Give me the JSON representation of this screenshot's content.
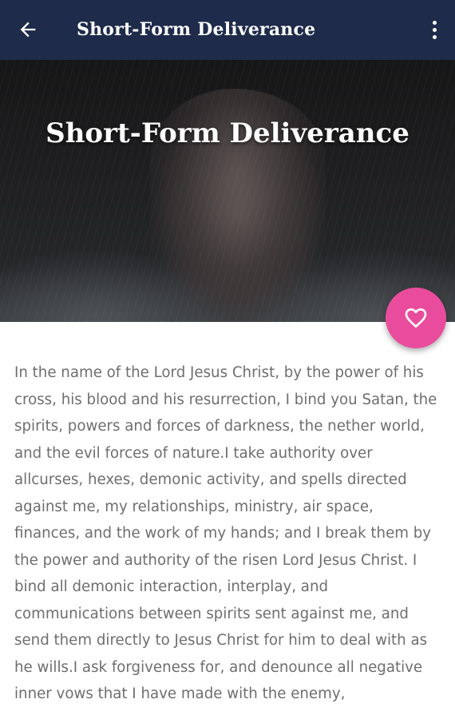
{
  "app_bar": {
    "title": "Short-Form Deliverance",
    "back_icon": "arrow-back-icon",
    "menu_icon": "more-vert-icon",
    "background_color": "#1e2b4a"
  },
  "hero": {
    "title": "Short-Form Deliverance"
  },
  "fab": {
    "icon": "heart-outline-icon",
    "color": "#ea4c9d"
  },
  "content": {
    "body": "In the name of the Lord Jesus Christ, by the power of his cross, his blood and his resurrection, I bind you Satan, the spirits, powers and forces of darkness, the nether world, and the evil forces of nature.I take authority over allcurses, hexes, demonic activity, and spells directed against me, my relationships, ministry, air space, finances, and the work of my hands; and I break them by the power and authority of the risen Lord Jesus Christ. I bind all demonic interaction, interplay, and communications between spirits sent against me, and send them directly to Jesus Christ for him to deal with as he wills.I ask forgiveness for, and denounce all negative inner vows that I have made with the enemy,",
    "text_color": "#6e6e6e"
  }
}
